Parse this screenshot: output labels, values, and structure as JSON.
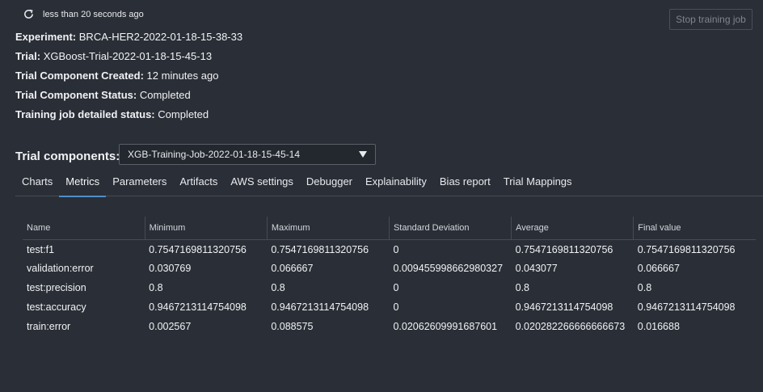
{
  "header": {
    "refresh_text": "less than 20 seconds ago",
    "stop_button_label": "Stop training job"
  },
  "info": [
    {
      "label": "Experiment:",
      "value": "BRCA-HER2-2022-01-18-15-38-33"
    },
    {
      "label": "Trial:",
      "value": "XGBoost-Trial-2022-01-18-15-45-13"
    },
    {
      "label": "Trial Component Created:",
      "value": "12 minutes ago"
    },
    {
      "label": "Trial Component Status:",
      "value": "Completed"
    },
    {
      "label": "Training job detailed status:",
      "value": "Completed"
    }
  ],
  "trial_components": {
    "label": "Trial components:",
    "selected": "XGB-Training-Job-2022-01-18-15-45-14"
  },
  "tabs": [
    {
      "label": "Charts"
    },
    {
      "label": "Metrics",
      "active": true
    },
    {
      "label": "Parameters"
    },
    {
      "label": "Artifacts"
    },
    {
      "label": "AWS settings"
    },
    {
      "label": "Debugger"
    },
    {
      "label": "Explainability"
    },
    {
      "label": "Bias report"
    },
    {
      "label": "Trial Mappings"
    }
  ],
  "metrics_table": {
    "columns": [
      "Name",
      "Minimum",
      "Maximum",
      "Standard Deviation",
      "Average",
      "Final value"
    ],
    "rows": [
      [
        "test:f1",
        "0.7547169811320756",
        "0.7547169811320756",
        "0",
        "0.7547169811320756",
        "0.7547169811320756"
      ],
      [
        "validation:error",
        "0.030769",
        "0.066667",
        "0.009455998662980327",
        "0.043077",
        "0.066667"
      ],
      [
        "test:precision",
        "0.8",
        "0.8",
        "0",
        "0.8",
        "0.8"
      ],
      [
        "test:accuracy",
        "0.9467213114754098",
        "0.9467213114754098",
        "0",
        "0.9467213114754098",
        "0.9467213114754098"
      ],
      [
        "train:error",
        "0.002567",
        "0.088575",
        "0.02062609991687601",
        "0.020282266666666673",
        "0.016688"
      ]
    ]
  }
}
